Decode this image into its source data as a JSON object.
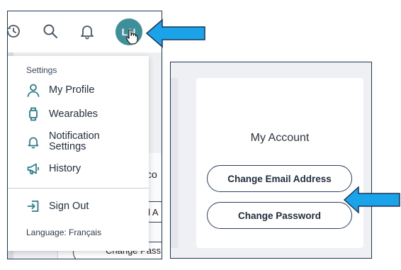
{
  "topbar": {
    "icons": [
      "history-icon",
      "search-icon",
      "bell-icon"
    ],
    "avatar_initials": "LN",
    "avatar_color": "#3f8f9a"
  },
  "menu": {
    "heading": "Settings",
    "items": [
      {
        "label": "My Profile",
        "icon": "person-icon"
      },
      {
        "label": "Wearables",
        "icon": "watch-icon"
      },
      {
        "label": "Notification Settings",
        "icon": "bell-icon"
      },
      {
        "label": "History",
        "icon": "megaphone-icon"
      }
    ],
    "sign_out": {
      "label": "Sign Out",
      "icon": "sign-out-icon"
    },
    "language_label": "Language: Français"
  },
  "background": {
    "text_co": "co",
    "text_ail": "ail A",
    "text_pass": "Change Pass"
  },
  "account": {
    "title": "My Account",
    "change_email_label": "Change Email Address",
    "change_password_label": "Change Password"
  },
  "colors": {
    "arrow_fill": "#1aa3e8",
    "arrow_stroke": "#1d3557",
    "border": "#1d3557"
  }
}
